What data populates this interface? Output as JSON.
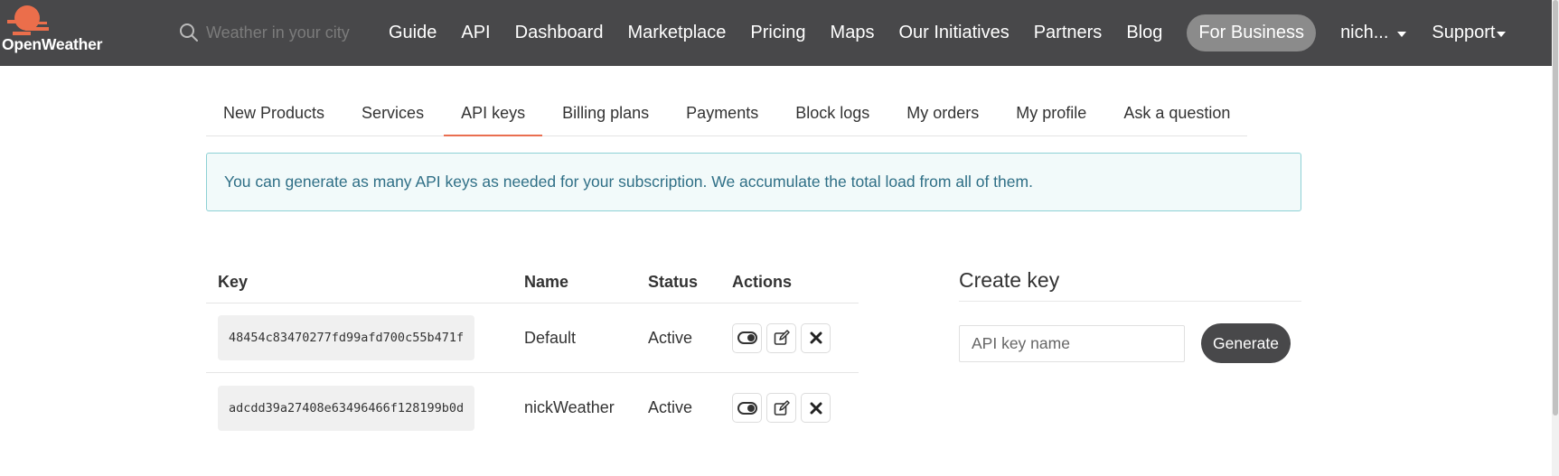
{
  "nav": {
    "logo_text": "OpenWeather",
    "search_placeholder": "Weather in your city",
    "items": [
      "Guide",
      "API",
      "Dashboard",
      "Marketplace",
      "Pricing",
      "Maps",
      "Our Initiatives",
      "Partners",
      "Blog"
    ],
    "business": "For Business",
    "user": "nich...",
    "support": "Support"
  },
  "tabs": {
    "items": [
      "New Products",
      "Services",
      "API keys",
      "Billing plans",
      "Payments",
      "Block logs",
      "My orders",
      "My profile",
      "Ask a question"
    ],
    "active": "API keys"
  },
  "alert": {
    "text": "You can generate as many API keys as needed for your subscription. We accumulate the total load from all of them."
  },
  "table": {
    "headers": {
      "key": "Key",
      "name": "Name",
      "status": "Status",
      "actions": "Actions"
    },
    "rows": [
      {
        "key": "48454c83470277fd99afd700c55b471f",
        "name": "Default",
        "status": "Active"
      },
      {
        "key": "adcdd39a27408e63496466f128199b0d",
        "name": "nickWeather",
        "status": "Active"
      }
    ]
  },
  "create": {
    "title": "Create key",
    "input_placeholder": "API key name",
    "button": "Generate"
  },
  "colors": {
    "topbar": "#48484a",
    "accent": "#e96e50",
    "alert_bg": "#f2fafa",
    "alert_border": "#8ed1d5",
    "alert_text": "#2f6f86"
  },
  "icons": {
    "toggle": "toggle-icon",
    "edit": "edit-icon",
    "delete": "close-icon"
  }
}
